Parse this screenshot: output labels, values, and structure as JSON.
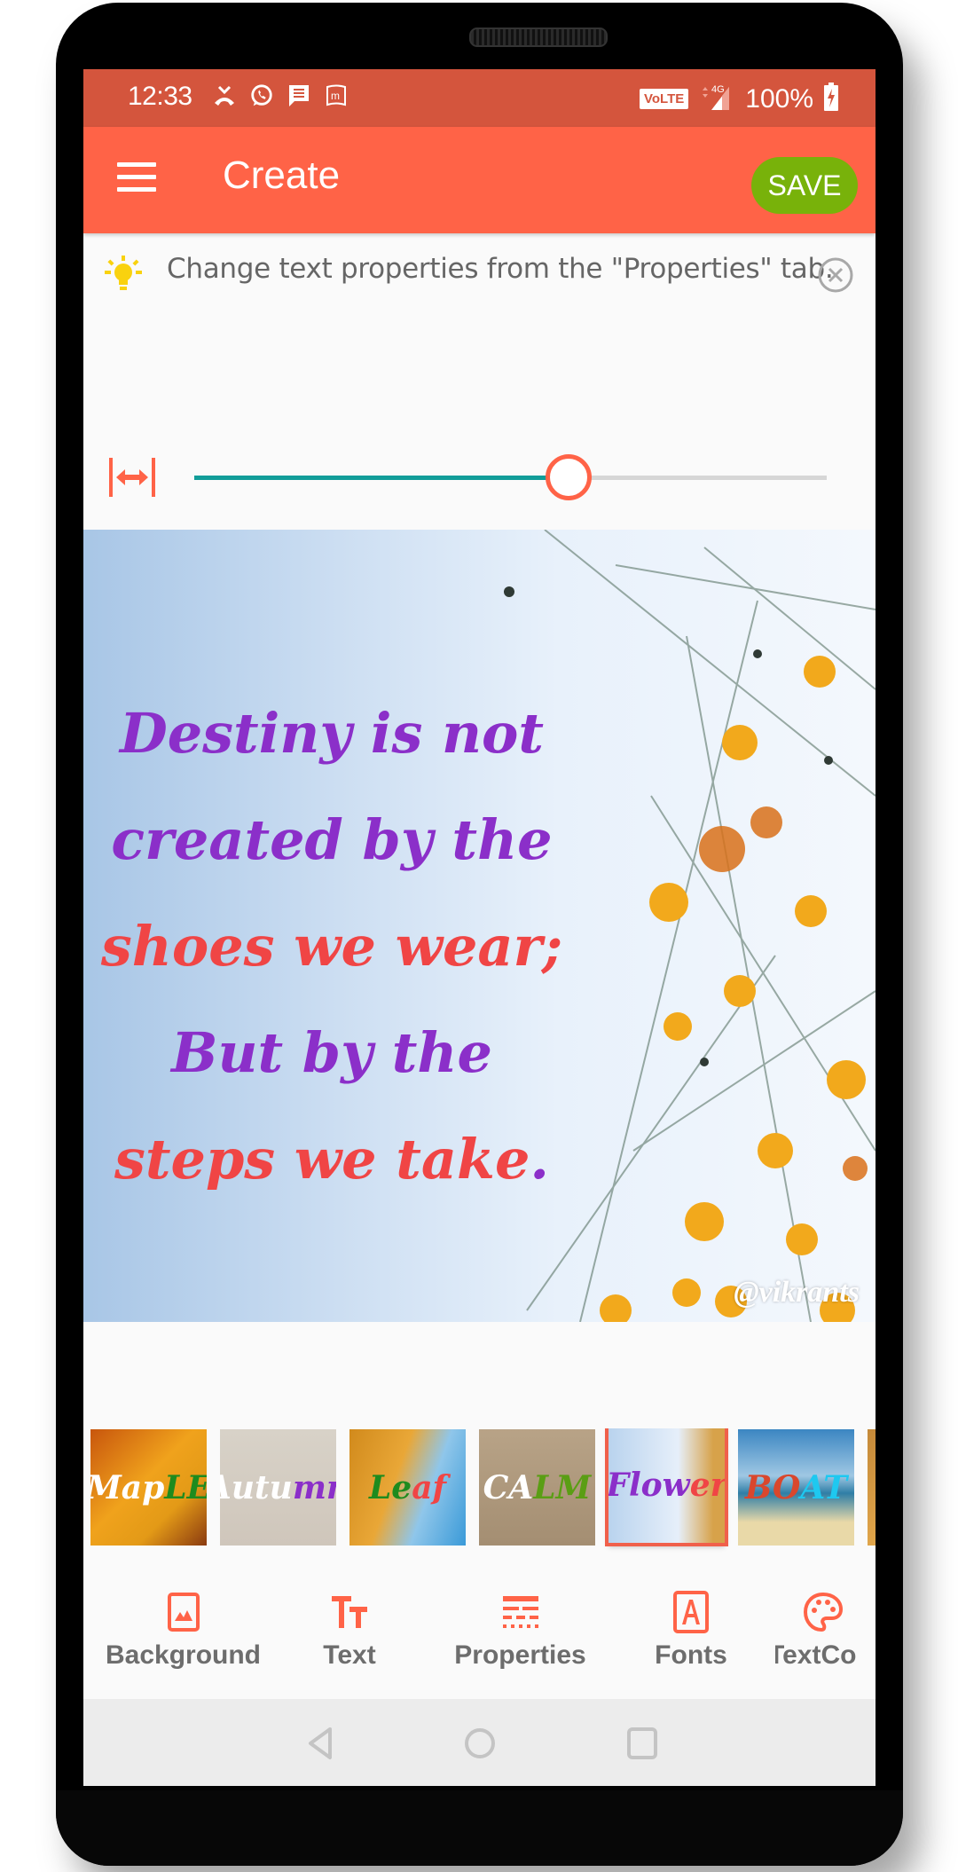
{
  "status_bar": {
    "time": "12:33",
    "notification_icons": [
      "missed-call-icon",
      "whatsapp-icon",
      "message-icon",
      "m-app-icon"
    ],
    "volte": "VoLTE",
    "network": "4G",
    "battery": "100%"
  },
  "toolbar": {
    "title": "Create",
    "save_label": "SAVE",
    "colors": {
      "status": "#d4553d",
      "toolbar": "#ff6347",
      "save": "#78b20a"
    }
  },
  "hint": {
    "text": "Change text properties from the \"Properties\" tab."
  },
  "slider": {
    "label": "text-width",
    "value_fraction": 0.59,
    "colors": {
      "fill": "#119d99",
      "track": "#d6d6d6",
      "thumb": "#ff6347"
    }
  },
  "canvas": {
    "lines": [
      {
        "text": "Destiny is not",
        "color": "#8b2fc9"
      },
      {
        "text": "created by the",
        "color": "#8b2fc9"
      },
      {
        "text": "shoes we wear;",
        "color": "#f04545"
      },
      {
        "text": "But by the",
        "color": "#8b2fc9"
      },
      {
        "text": "steps we take",
        "color": "#f04545",
        "suffix": ".",
        "suffix_color": "#8b2fc9"
      }
    ],
    "watermark": "@vikrants"
  },
  "templates": {
    "items": [
      {
        "name": "Maple",
        "parts": [
          "Map",
          "LE"
        ],
        "colors": [
          "#ffffff",
          "#1e8b1e"
        ],
        "bg": "linear-gradient(135deg,#c8560d,#f0a21c 45%,#e39a17 70%,#8a3a10)"
      },
      {
        "name": "Autumn",
        "parts": [
          "Autu",
          "mn"
        ],
        "colors": [
          "#ffffff",
          "#8b2fc9"
        ],
        "bg": "linear-gradient(180deg,#d8d2c8,#cfc6bb)"
      },
      {
        "name": "Leaf",
        "parts": [
          "Le",
          "af"
        ],
        "colors": [
          "#1e8b1e",
          "#f04545"
        ],
        "bg": "linear-gradient(110deg,#d18a1c 0%,#e9a737 40%,#8fc6ea 65%,#3a9ad8 100%)"
      },
      {
        "name": "CALM",
        "parts": [
          "CA",
          "LM"
        ],
        "colors": [
          "#ffffff",
          "#5a9e14"
        ],
        "bg": "linear-gradient(180deg,#b8a387,#a48e72)"
      },
      {
        "name": "Flower",
        "parts": [
          "Flow",
          "er"
        ],
        "colors": [
          "#8b2fc9",
          "#f04545"
        ],
        "bg": "linear-gradient(90deg,#b9d3ee,#e6effa 60%,#d7a24a 90%)",
        "selected": true
      },
      {
        "name": "BOAT",
        "parts": [
          "BO",
          "AT"
        ],
        "colors": [
          "#d9472d",
          "#1ec8f0"
        ],
        "bg": "linear-gradient(180deg,#3b86c2 0%,#9fc7e3 40%,#2f7ea6 55%,#e9d9a8 80%)"
      },
      {
        "name": "",
        "parts": [
          "",
          ""
        ],
        "colors": [
          "#ffffff",
          "#ffffff"
        ],
        "bg": "linear-gradient(180deg,#c58a3a,#e0a54a)"
      }
    ],
    "selected_border": "#f0604b"
  },
  "bottom_tabs": [
    {
      "label": "Background",
      "icon": "image-icon"
    },
    {
      "label": "Text",
      "icon": "text-size-icon"
    },
    {
      "label": "Properties",
      "icon": "line-style-icon"
    },
    {
      "label": "Fonts",
      "icon": "font-box-icon"
    },
    {
      "label": "TextCo",
      "icon": "palette-icon"
    }
  ],
  "nav": {
    "back": "back-icon",
    "home": "home-icon",
    "recents": "recents-icon"
  }
}
